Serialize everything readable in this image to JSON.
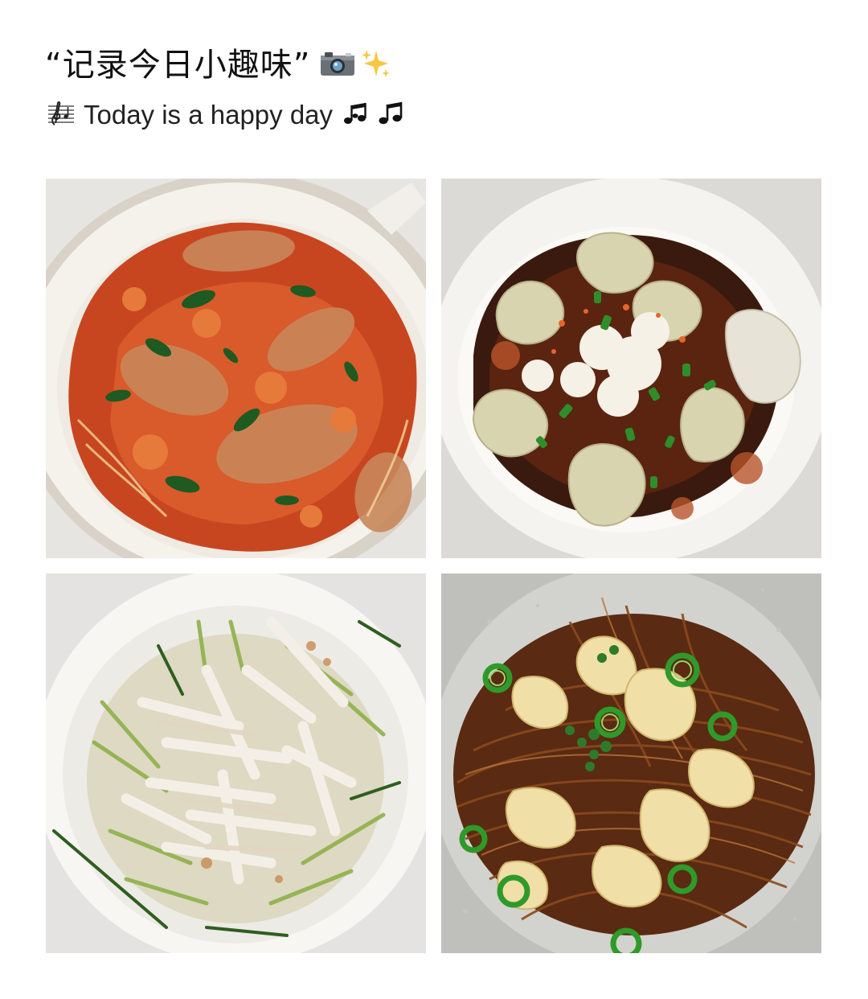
{
  "header": {
    "title": "“记录今日小趣味”",
    "title_emojis": [
      "camera-icon",
      "sparkles-icon"
    ],
    "subtitle": "Today is a happy day",
    "subtitle_emojis": [
      "music-score-icon",
      "music-notes-icon",
      "music-note-icon"
    ]
  },
  "photos": [
    {
      "name": "tomato-beef-noodles-photo"
    },
    {
      "name": "chili-oil-wontons-photo"
    },
    {
      "name": "shredded-chicken-cucumber-photo"
    },
    {
      "name": "abalone-scallion-noodles-photo"
    }
  ],
  "colors": {
    "background": "#ffffff",
    "text": "#111111"
  }
}
